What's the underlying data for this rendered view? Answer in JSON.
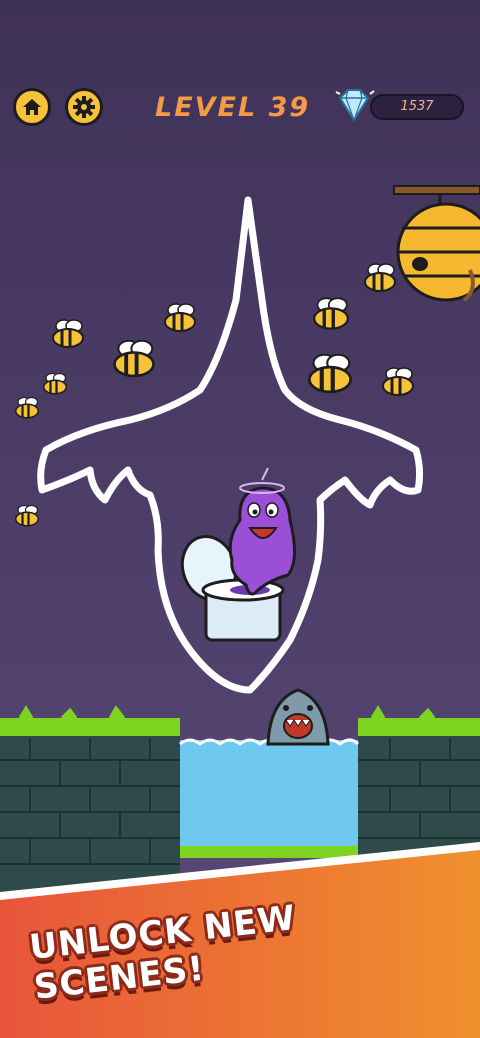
{
  "hud": {
    "level_label": "LEVEL 39",
    "gem_count": "1537",
    "home_icon": "home-icon",
    "settings_icon": "gear-icon",
    "gem_icon": "diamond-icon"
  },
  "banner": {
    "text": "UNLOCK NEW SCENES!"
  },
  "colors": {
    "sky_top": "#3f3258",
    "sky_bottom": "#5a4a78",
    "accent_orange": "#f29a45",
    "button_yellow": "#f6c23a",
    "grass": "#7ed321",
    "brick": "#2e4a4a",
    "water": "#6ec8f0",
    "banner_start": "#e8553a",
    "banner_end": "#f0902e"
  }
}
